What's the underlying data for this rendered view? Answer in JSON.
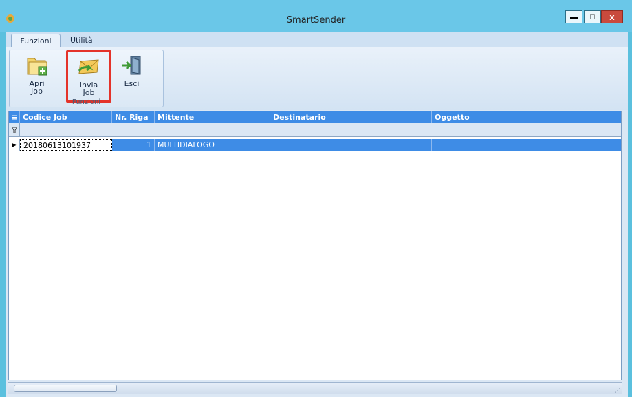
{
  "window": {
    "title": "SmartSender",
    "app_icon": "smartsender-icon",
    "minimize_symbol": "▬",
    "maximize_symbol": "□",
    "close_symbol": "x"
  },
  "ribbon": {
    "tabs": [
      {
        "label": "Funzioni",
        "active": true
      },
      {
        "label": "Utilità",
        "active": false
      }
    ],
    "group_label": "Funzioni",
    "buttons": [
      {
        "label_line1": "Apri",
        "label_line2": "Job",
        "icon": "open-folder-icon"
      },
      {
        "label_line1": "Invia",
        "label_line2": "Job",
        "icon": "send-mail-icon",
        "highlighted": true
      },
      {
        "label_line1": "Esci",
        "label_line2": "",
        "icon": "exit-door-icon"
      }
    ]
  },
  "grid": {
    "columns": [
      "Codice Job",
      "Nr. Riga",
      "Mittente",
      "Destinatario",
      "Oggetto"
    ],
    "rows": [
      {
        "codice_job": "20180613101937",
        "nr_riga": "1",
        "mittente": "MULTIDIALOGO",
        "destinatario": "",
        "oggetto": ""
      }
    ]
  },
  "colors": {
    "title_bar": "#6ac7e8",
    "header_blue": "#3e8ce6",
    "highlight_border": "#e4332a"
  }
}
